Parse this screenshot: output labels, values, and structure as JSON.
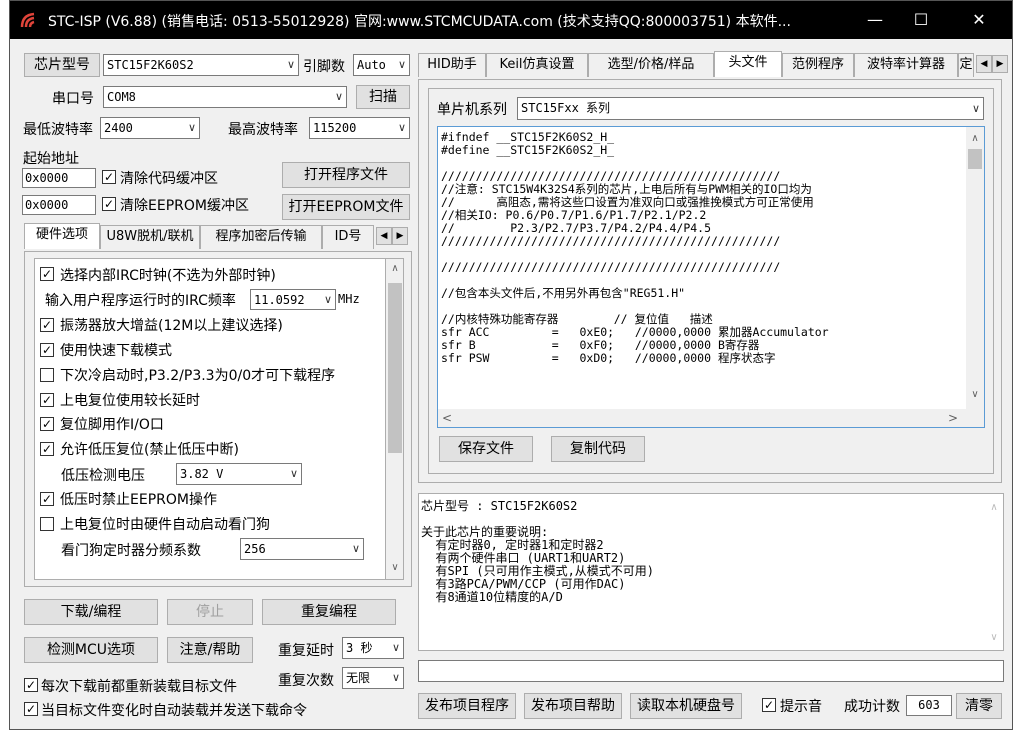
{
  "window": {
    "title": "STC-ISP (V6.88) (销售电话: 0513-55012928) 官网:www.STCMCUDATA.com  (技术支持QQ:800003751) 本软件...",
    "minimize": "—",
    "maximize": "☐",
    "close": "✕"
  },
  "left": {
    "chip_type_button": "芯片型号",
    "chip_type_value": "STC15F2K60S2",
    "pins_label": "引脚数",
    "pins_value": "Auto",
    "port_label": "串口号",
    "port_value": "COM8",
    "scan_button": "扫描",
    "min_baud_label": "最低波特率",
    "min_baud_value": "2400",
    "max_baud_label": "最高波特率",
    "max_baud_value": "115200",
    "start_addr_label": "起始地址",
    "addr1_value": "0x0000",
    "clear_code_label": "清除代码缓冲区",
    "open_prog_button": "打开程序文件",
    "addr2_value": "0x0000",
    "clear_eeprom_label": "清除EEPROM缓冲区",
    "open_eeprom_button": "打开EEPROM文件",
    "tabs": [
      "硬件选项",
      "U8W脱机/联机",
      "程序加密后传输",
      "ID号"
    ],
    "options": {
      "irc_clock": "选择内部IRC时钟(不选为外部时钟)",
      "irc_freq_label": "输入用户程序运行时的IRC频率",
      "irc_freq_value": "11.0592",
      "irc_freq_unit": "MHz",
      "osc_gain": "振荡器放大增益(12M以上建议选择)",
      "fast_download": "使用快速下载模式",
      "cold_start": "下次冷启动时,P3.2/P3.3为0/0才可下载程序",
      "power_delay": "上电复位使用较长延时",
      "reset_io": "复位脚用作I/O口",
      "lvr": "允许低压复位(禁止低压中断)",
      "lv_label": "低压检测电压",
      "lv_value": "3.82 V",
      "lv_eeprom": "低压时禁止EEPROM操作",
      "wdt_auto": "上电复位时由硬件自动启动看门狗",
      "wdt_div_label": "看门狗定时器分频系数",
      "wdt_div_value": "256"
    },
    "download_button": "下载/编程",
    "stop_button": "停止",
    "reprogram_button": "重复编程",
    "detect_button": "检测MCU选项",
    "help_button": "注意/帮助",
    "repeat_delay_label": "重复延时",
    "repeat_delay_value": "3 秒",
    "repeat_count_label": "重复次数",
    "repeat_count_value": "无限",
    "reload_label": "每次下载前都重新装载目标文件",
    "auto_load_label": "当目标文件变化时自动装载并发送下载命令"
  },
  "right": {
    "tabs": [
      "HID助手",
      "Keil仿真设置",
      "选型/价格/样品",
      "头文件",
      "范例程序",
      "波特率计算器",
      "定"
    ],
    "series_label": "单片机系列",
    "series_value": "STC15Fxx 系列",
    "code_lines": [
      "#ifndef __STC15F2K60S2_H_",
      "#define __STC15F2K60S2_H_",
      "",
      "/////////////////////////////////////////////////",
      "//注意: STC15W4K32S4系列的芯片,上电后所有与PWM相关的IO口均为",
      "//      高阻态,需将这些口设置为准双向口或强推挽模式方可正常使用",
      "//相关IO: P0.6/P0.7/P1.6/P1.7/P2.1/P2.2",
      "//        P2.3/P2.7/P3.7/P4.2/P4.4/P4.5",
      "/////////////////////////////////////////////////",
      "",
      "/////////////////////////////////////////////////",
      "",
      "//包含本头文件后,不用另外再包含\"REG51.H\"",
      "",
      "//内核特殊功能寄存器        // 复位值   描述",
      "sfr ACC         =   0xE0;   //0000,0000 累加器Accumulator",
      "sfr B           =   0xF0;   //0000,0000 B寄存器",
      "sfr PSW         =   0xD0;   //0000,0000 程序状态字"
    ],
    "save_button": "保存文件",
    "copy_button": "复制代码",
    "info_lines": [
      "芯片型号 : STC15F2K60S2",
      "",
      "关于此芯片的重要说明:",
      "  有定时器0, 定时器1和定时器2",
      "  有两个硬件串口 (UART1和UART2)",
      "  有SPI (只可用作主模式,从模式不可用)",
      "  有3路PCA/PWM/CCP (可用作DAC)",
      "  有8通道10位精度的A/D"
    ],
    "publish_button": "发布项目程序",
    "publish_help_button": "发布项目帮助",
    "read_disk_button": "读取本机硬盘号",
    "beep_label": "提示音",
    "success_label": "成功计数",
    "success_value": "603",
    "clear_button": "清零"
  }
}
